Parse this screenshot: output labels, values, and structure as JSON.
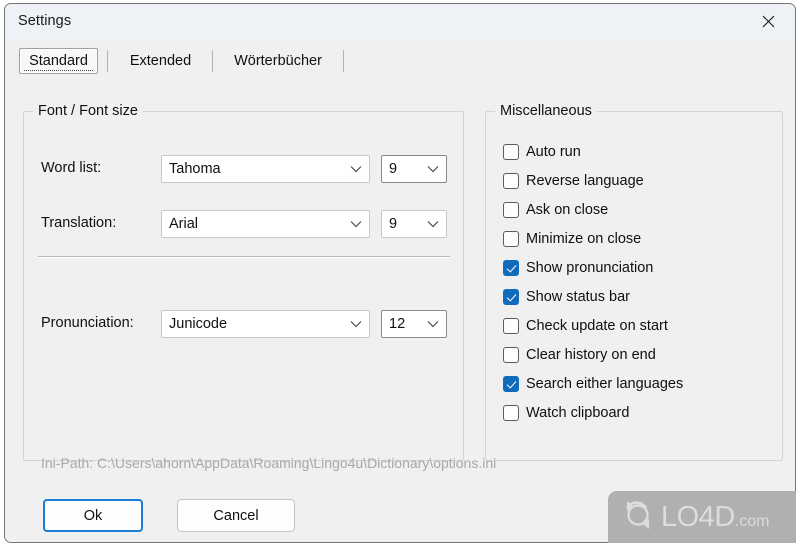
{
  "window": {
    "title": "Settings",
    "close_icon": "close-icon"
  },
  "tabs": [
    {
      "label": "Standard",
      "selected": true
    },
    {
      "label": "Extended",
      "selected": false
    },
    {
      "label": "Wörterbücher",
      "selected": false
    }
  ],
  "font_group": {
    "legend": "Font / Font size",
    "rows": [
      {
        "label": "Word list:",
        "font": "Tahoma",
        "size": "9",
        "size_strong": true
      },
      {
        "label": "Translation:",
        "font": "Arial",
        "size": "9",
        "size_strong": false
      },
      {
        "label": "Pronunciation:",
        "font": "Junicode",
        "size": "12",
        "size_strong": true
      }
    ]
  },
  "misc_group": {
    "legend": "Miscellaneous",
    "checkboxes": [
      {
        "label": "Auto run",
        "checked": false
      },
      {
        "label": "Reverse language",
        "checked": false
      },
      {
        "label": "Ask on close",
        "checked": false
      },
      {
        "label": "Minimize on close",
        "checked": false
      },
      {
        "label": "Show pronunciation",
        "checked": true
      },
      {
        "label": "Show status bar",
        "checked": true
      },
      {
        "label": "Check update on start",
        "checked": false
      },
      {
        "label": "Clear history on end",
        "checked": false
      },
      {
        "label": "Search either languages",
        "checked": true
      },
      {
        "label": "Watch clipboard",
        "checked": false
      }
    ]
  },
  "ini_path": "Ini-Path: C:\\Users\\ahorn\\AppData\\Roaming\\Lingo4u\\Dictionary\\options.ini",
  "buttons": {
    "ok": "Ok",
    "cancel": "Cancel"
  },
  "watermark": {
    "name": "LO4D",
    "suffix": ".com"
  },
  "colors": {
    "accent": "#0f6cbd",
    "default_button_border": "#1a7fd4",
    "dialog_background": "#f0f0f0",
    "titlebar_background": "#eef1f6",
    "muted_text": "#a8a8a8"
  }
}
